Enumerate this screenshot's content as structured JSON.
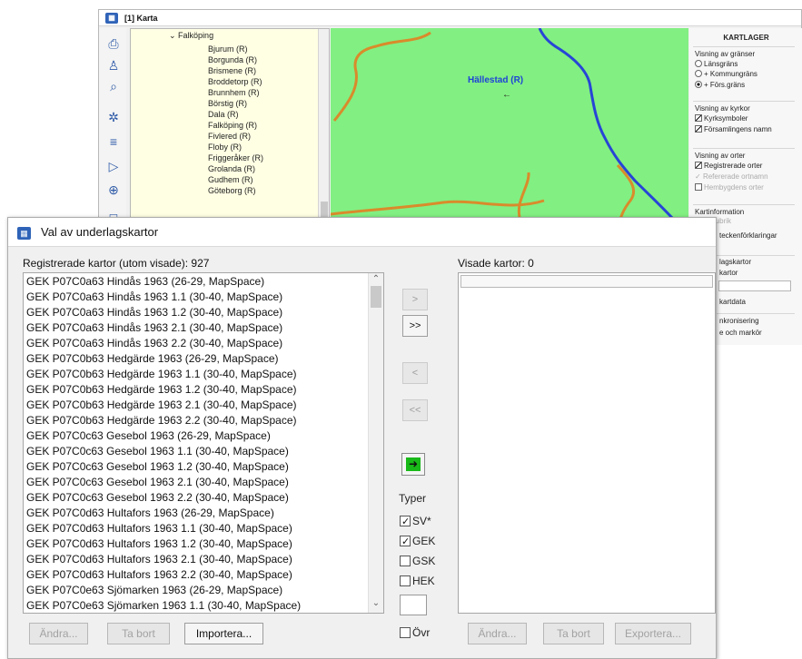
{
  "colors": {
    "map_green": "#82ef82",
    "map_orange": "#d98b2b",
    "map_blue": "#2745d6",
    "tree_background": "#ffffe4",
    "accent_blue": "#2f63b8",
    "dialog_background": "#f0f0f0"
  },
  "map_window": {
    "app_icon": "map-app-icon",
    "title": "[1] Karta",
    "toolbar_icons": [
      "printer-icon",
      "user-search-icon",
      "search-icon",
      "settings-icon",
      "menu-icon",
      "pointer-icon",
      "zoom-icon",
      "ruler-icon"
    ],
    "tree": {
      "root": "Falköping",
      "items": [
        "Bjurum (R)",
        "Borgunda (R)",
        "Brismene (R)",
        "Broddetorp (R)",
        "Brunnhem (R)",
        "Börstig (R)",
        "Dala (R)",
        "Falköping (R)",
        "Fivlered (R)",
        "Floby (R)",
        "Friggeråker (R)",
        "Grolanda (R)",
        "Gudhem (R)",
        "Göteborg (R)"
      ]
    },
    "map": {
      "place_label": "Hällestad (R)",
      "marker": "←"
    },
    "layers": {
      "title": "KARTLAGER",
      "borders": {
        "label": "Visning av gränser",
        "options": [
          "Länsgräns",
          "+ Kommungräns",
          "+ Förs.gräns"
        ],
        "selected": 2
      },
      "churches": {
        "label": "Visning av kyrkor",
        "items": [
          "Kyrksymboler",
          "Församlingens namn"
        ]
      },
      "places": {
        "label": "Visning av orter",
        "items": [
          "Registrerade orter",
          "Refererade ortnamn",
          "Hembygdens orter"
        ]
      },
      "map_info": {
        "label": "Kartinformation",
        "items": [
          "rubrik",
          "teckenförklaringar"
        ]
      },
      "base_maps": {
        "label": "lagskartor",
        "items": [
          "kartor",
          "kartdata"
        ]
      },
      "sync": {
        "label": "nkronisering",
        "items": [
          "e och markör"
        ]
      }
    }
  },
  "dialog": {
    "icon": "map-app-icon",
    "title": "Val av underlagskartor",
    "left_header": "Registrerade kartor (utom visade): 927",
    "right_header": "Visade kartor: 0",
    "registered_maps": [
      "GEK P07C0a63 Hindås 1963 (26-29, MapSpace)",
      "GEK P07C0a63 Hindås 1963 1.1 (30-40, MapSpace)",
      "GEK P07C0a63 Hindås 1963 1.2 (30-40, MapSpace)",
      "GEK P07C0a63 Hindås 1963 2.1 (30-40, MapSpace)",
      "GEK P07C0a63 Hindås 1963 2.2 (30-40, MapSpace)",
      "GEK P07C0b63 Hedgärde 1963 (26-29, MapSpace)",
      "GEK P07C0b63 Hedgärde 1963 1.1 (30-40, MapSpace)",
      "GEK P07C0b63 Hedgärde 1963 1.2 (30-40, MapSpace)",
      "GEK P07C0b63 Hedgärde 1963 2.1 (30-40, MapSpace)",
      "GEK P07C0b63 Hedgärde 1963 2.2 (30-40, MapSpace)",
      "GEK P07C0c63 Gesebol 1963 (26-29, MapSpace)",
      "GEK P07C0c63 Gesebol 1963 1.1 (30-40, MapSpace)",
      "GEK P07C0c63 Gesebol 1963 1.2 (30-40, MapSpace)",
      "GEK P07C0c63 Gesebol 1963 2.1 (30-40, MapSpace)",
      "GEK P07C0c63 Gesebol 1963 2.2 (30-40, MapSpace)",
      "GEK P07C0d63 Hultafors 1963 (26-29, MapSpace)",
      "GEK P07C0d63 Hultafors 1963 1.1 (30-40, MapSpace)",
      "GEK P07C0d63 Hultafors 1963 1.2 (30-40, MapSpace)",
      "GEK P07C0d63 Hultafors 1963 2.1 (30-40, MapSpace)",
      "GEK P07C0d63 Hultafors 1963 2.2 (30-40, MapSpace)",
      "GEK P07C0e63 Sjömarken 1963 (26-29, MapSpace)",
      "GEK P07C0e63 Sjömarken 1963 1.1 (30-40, MapSpace)"
    ],
    "move_buttons": [
      ">",
      ">>",
      "<",
      "<<"
    ],
    "green_button_icon": "green-arrow-icon",
    "green_arrow": "➜",
    "types": {
      "title": "Typer",
      "items": [
        {
          "label": "SV*",
          "checked": true
        },
        {
          "label": "GEK",
          "checked": true
        },
        {
          "label": "GSK",
          "checked": false
        },
        {
          "label": "HEK",
          "checked": false
        },
        {
          "label": "Övr",
          "checked": false
        }
      ],
      "text_value": ""
    },
    "buttons": {
      "left": [
        "Ändra...",
        "Ta bort",
        "Importera..."
      ],
      "right": [
        "Ändra...",
        "Ta bort",
        "Exportera..."
      ]
    }
  }
}
